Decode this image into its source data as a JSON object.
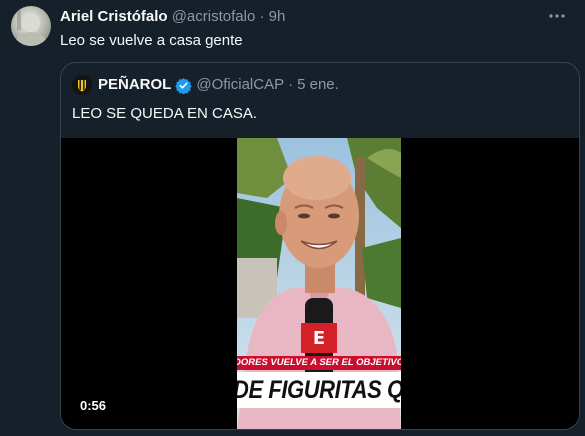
{
  "tweet": {
    "author_name": "Ariel Cristófalo",
    "author_handle": "@acristofalo",
    "separator": "·",
    "time": "9h",
    "text": "Leo se vuelve a casa gente",
    "more_icon": "more-horizontal-icon"
  },
  "quote": {
    "author_name": "PEÑAROL",
    "verified_icon": "verified-badge-icon",
    "author_handle": "@OficialCAP",
    "separator": "·",
    "time": "5 ene.",
    "text": "LEO SE QUEDA EN CASA.",
    "video": {
      "duration": "0:56",
      "caption_top": "DORES VUELVE A SER EL OBJETIVO",
      "caption_bottom": "DE FIGURITAS QUE NECE",
      "mic_logo": "E"
    }
  },
  "colors": {
    "background": "#15202b",
    "text": "#f7f9f9",
    "muted": "#8b98a5",
    "border": "#38444d",
    "verified": "#1d9bf0",
    "caption_red": "#c8102e"
  }
}
